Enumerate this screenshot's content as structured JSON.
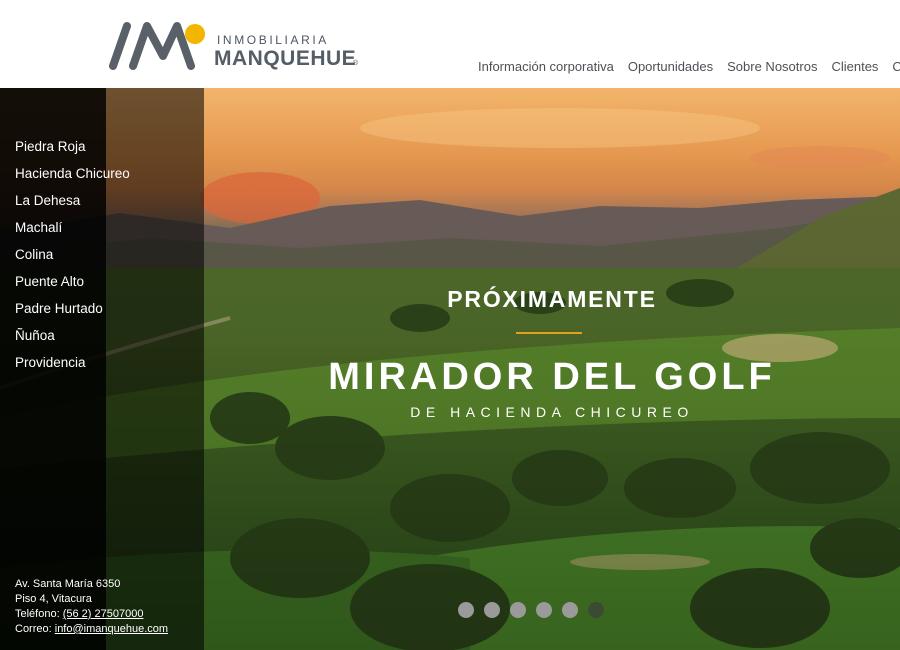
{
  "brand": {
    "name_top": "INMOBILIARIA",
    "name_main": "MANQUEHUE",
    "registered": "®",
    "colors": {
      "mark_gray": "#5a6068",
      "mark_yellow": "#f2b500"
    }
  },
  "nav": {
    "items": [
      "Información corporativa",
      "Oportunidades",
      "Sobre Nosotros",
      "Clientes",
      "Co"
    ]
  },
  "sidebar": {
    "items": [
      "Piedra Roja",
      "Hacienda Chicureo",
      "La Dehesa",
      "Machalí",
      "Colina",
      "Puente Alto",
      "Padre Hurtado",
      "Ñuñoa",
      "Providencia"
    ]
  },
  "contact": {
    "address_line1": "Av. Santa María 6350",
    "address_line2": "Piso 4, Vitacura",
    "phone_label": "Teléfono:",
    "phone": "(56 2) 27507000",
    "email_label": "Correo:",
    "email": "info@imanquehue.com"
  },
  "hero": {
    "pre_title": "PRÓXIMAMENTE",
    "title": "MIRADOR DEL GOLF",
    "subtitle": "DE HACIENDA CHICUREO",
    "accent_color": "#e2a11b"
  },
  "slider": {
    "slide_count": 6,
    "active_index": 5
  }
}
